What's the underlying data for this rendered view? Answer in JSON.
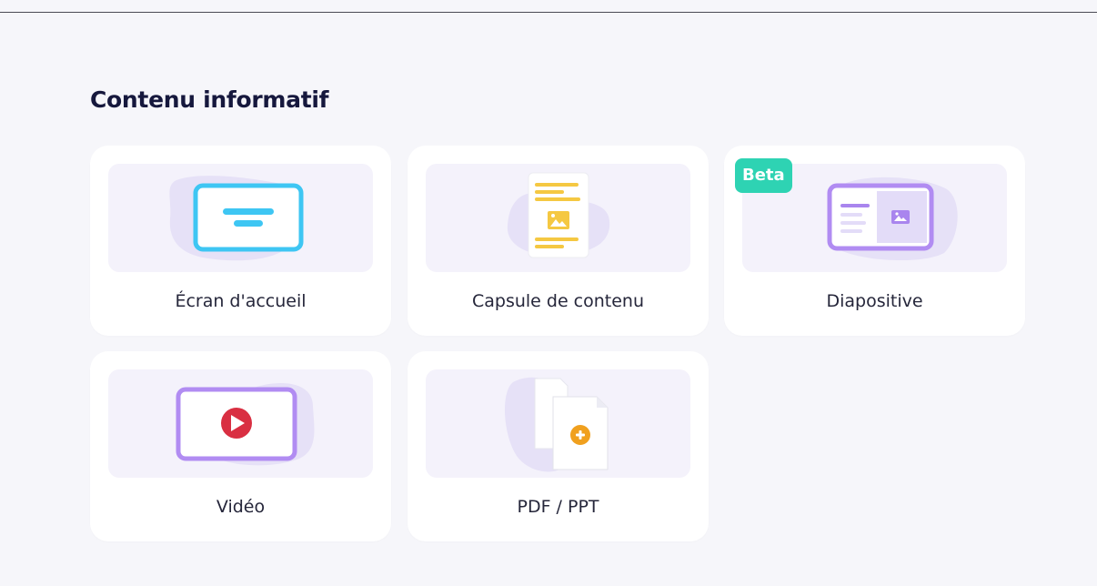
{
  "section": {
    "title": "Contenu informatif"
  },
  "cards": [
    {
      "label": "Écran d'accueil",
      "icon": "welcome-screen-icon"
    },
    {
      "label": "Capsule de contenu",
      "icon": "content-capsule-icon"
    },
    {
      "label": "Diapositive",
      "icon": "slide-icon",
      "badge": "Beta"
    },
    {
      "label": "Vidéo",
      "icon": "video-icon"
    },
    {
      "label": "PDF / PPT",
      "icon": "pdf-ppt-icon"
    }
  ],
  "colors": {
    "background": "#f6f6fa",
    "card": "#ffffff",
    "thumb": "#f4f2fb",
    "title": "#16183d",
    "beta_badge": "#2ed3b3",
    "cyan_accent": "#3ec6f3",
    "purple_accent": "#b18cf2",
    "yellow_accent": "#f5c842",
    "red_accent": "#d92f42",
    "orange_accent": "#f0a01e"
  }
}
